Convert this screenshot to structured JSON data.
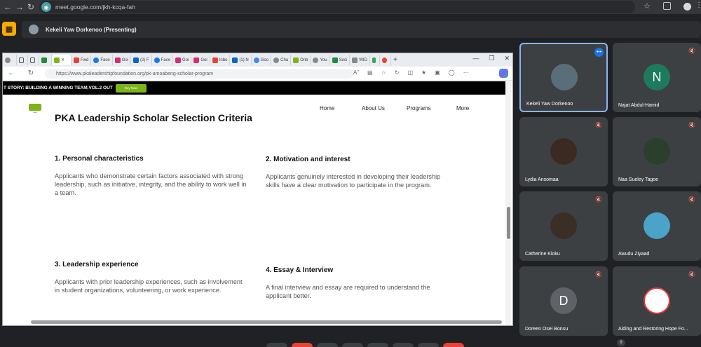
{
  "browser": {
    "url": "meet.google.com/jkh-kcqa-fah"
  },
  "meet": {
    "presenter_label": "Kekeli Yaw Dorkenoo (Presenting)"
  },
  "shared_window": {
    "tabs": [
      "Fwd",
      "Face",
      "Goi",
      "(2) F",
      "Face",
      "Goi",
      "Goi",
      "Inbo",
      "(1) N",
      "Goo",
      "Cha",
      "Onb",
      "You",
      "Soci",
      "WID"
    ],
    "url": "https://www.pkaleadershipfoundation.org/pk-amoabeng-scholar-program",
    "banner_text": "T STORY: BUILDING A WINNING TEAM,VOL.2 OUT",
    "banner_button": "Buy Now",
    "nav": [
      "Home",
      "About Us",
      "Programs",
      "More"
    ],
    "title": "PKA Leadership Scholar Selection Criteria",
    "criteria": [
      {
        "heading": "1. Personal characteristics",
        "text": "Applicants who demonstrate certain factors associated with strong leadership, such as initiative, integrity, and the ability to work well in a team."
      },
      {
        "heading": "2. Motivation and interest",
        "text": "Applicants genuinely interested in developing their leadership skills have a clear motivation to participate in the program."
      },
      {
        "heading": "3. Leadership experience",
        "text": "Applicants with prior leadership experiences, such as involvement in student organizations, volunteering, or work experience."
      },
      {
        "heading": "4. Essay & Interview",
        "text": "A final interview and essay are required to understand the applicant better."
      }
    ]
  },
  "participants": [
    {
      "name": "Kekeli Yaw Dorkenoo",
      "initial": "",
      "color": "#5a6e7a"
    },
    {
      "name": "Najat Abdul-Hamid",
      "initial": "N",
      "color": "#1e7a5c"
    },
    {
      "name": "Lydia Ansomaa",
      "initial": "",
      "color": "#3b2a22"
    },
    {
      "name": "Naa Sueley Tagoe",
      "initial": "",
      "color": "#2a3f2c"
    },
    {
      "name": "Catherine Kloku",
      "initial": "",
      "color": "#3a2e26"
    },
    {
      "name": "Awudu Ziyaad",
      "initial": "",
      "color": "#4ba3c7"
    },
    {
      "name": "Doreen Osei Bonsu",
      "initial": "D",
      "color": "#5f6368"
    },
    {
      "name": "Aiding and Restoring Hope Fo...",
      "initial": "",
      "color": "#ffffff"
    }
  ],
  "hidden_count": "9"
}
